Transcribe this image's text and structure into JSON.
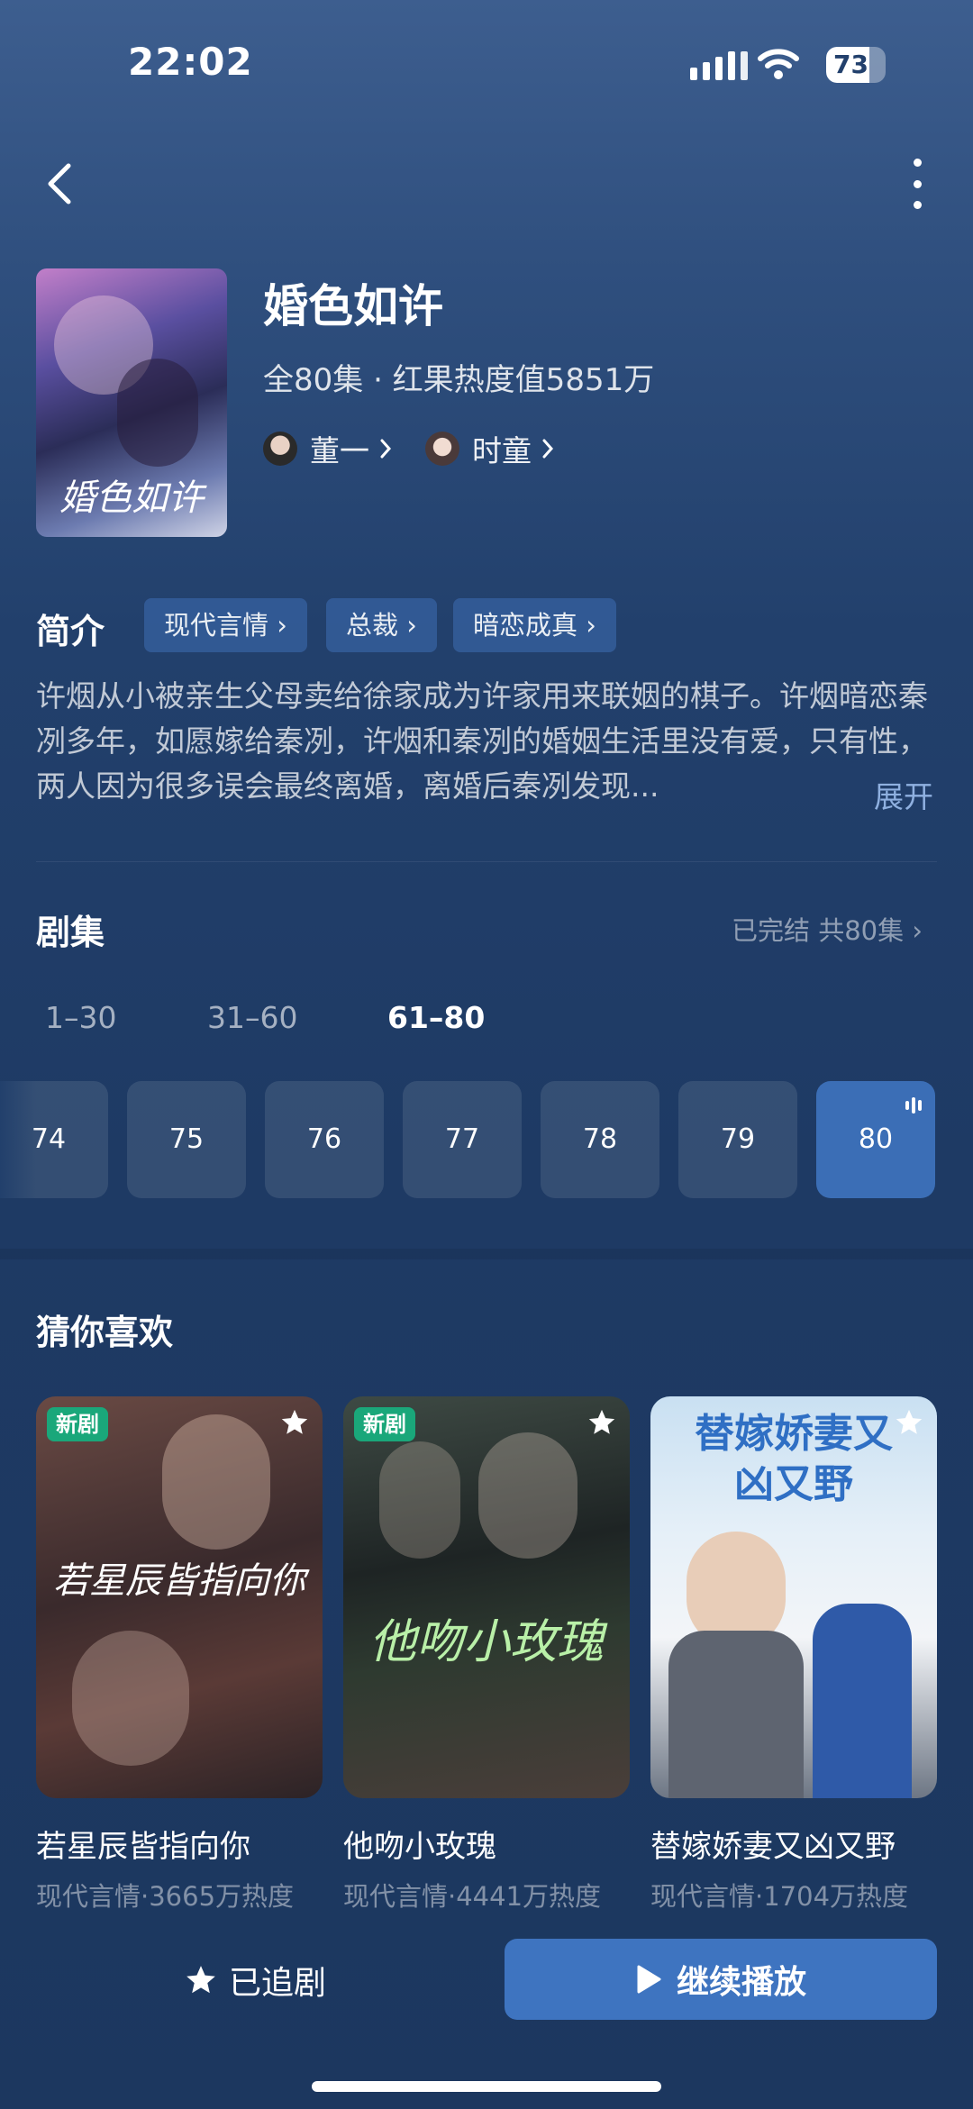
{
  "status_bar": {
    "time": "22:02",
    "battery": "73"
  },
  "drama": {
    "title": "婚色如许",
    "poster_text": "婚色如许",
    "meta": "全80集 · 红果热度值5851万",
    "actors": [
      {
        "name": "董一"
      },
      {
        "name": "时童"
      }
    ]
  },
  "intro": {
    "label": "简介",
    "tags": [
      "现代言情",
      "总裁",
      "暗恋成真"
    ],
    "text": "许烟从小被亲生父母卖给徐家成为许家用来联姻的棋子。许烟暗恋秦冽多年，如愿嫁给秦冽，许烟和秦冽的婚姻生活里没有爱，只有性，两人因为很多误会最终离婚，离婚后秦冽发现...",
    "expand": "展开"
  },
  "episodes": {
    "label": "剧集",
    "status": "已完结 共80集",
    "ranges": [
      "1–30",
      "31–60",
      "61–80"
    ],
    "active_range": "61–80",
    "list": [
      "74",
      "75",
      "76",
      "77",
      "78",
      "79",
      "80"
    ],
    "current": "80"
  },
  "recommend": {
    "label": "猜你喜欢",
    "items": [
      {
        "name": "若星辰皆指向你",
        "sub": "现代言情·3665万热度",
        "badge": "新剧",
        "art_text": "若星辰皆指向你"
      },
      {
        "name": "他吻小玫瑰",
        "sub": "现代言情·4441万热度",
        "badge": "新剧",
        "art_text": "他吻小玫瑰"
      },
      {
        "name": "替嫁娇妻又凶又野",
        "sub": "现代言情·1704万热度",
        "badge": "",
        "art_text": "替嫁娇妻又凶又野"
      }
    ]
  },
  "bottom": {
    "follow_label": "已追剧",
    "play_label": "继续播放"
  },
  "colors": {
    "accent": "#3e74c0",
    "new_badge": "#1aa77a"
  }
}
